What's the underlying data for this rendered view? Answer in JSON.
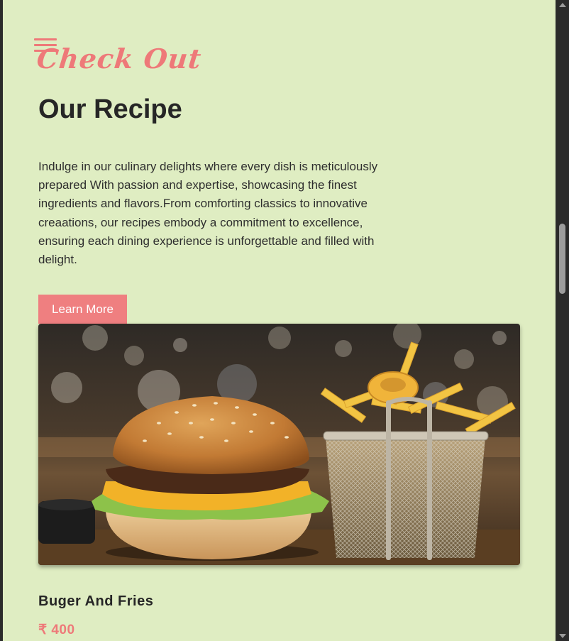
{
  "brand": {
    "logo_text": "Check Out"
  },
  "section": {
    "title": "Our Recipe",
    "description": "Indulge in our culinary delights where every dish is meticulously prepared With passion and expertise, showcasing the finest ingredients and flavors.From comforting classics to innovative creaations, our recipes embody a commitment to excellence, ensuring each dining experience is unforgettable and filled with delight.",
    "cta_label": "Learn More"
  },
  "item": {
    "name": "Buger And Fries",
    "price": "₹ 400"
  },
  "icons": {
    "menu": "hamburger-menu-icon"
  },
  "colors": {
    "accent": "#ee7979",
    "page_background": "#dfedc2",
    "text": "#262626",
    "button_background": "#ef7f80"
  }
}
